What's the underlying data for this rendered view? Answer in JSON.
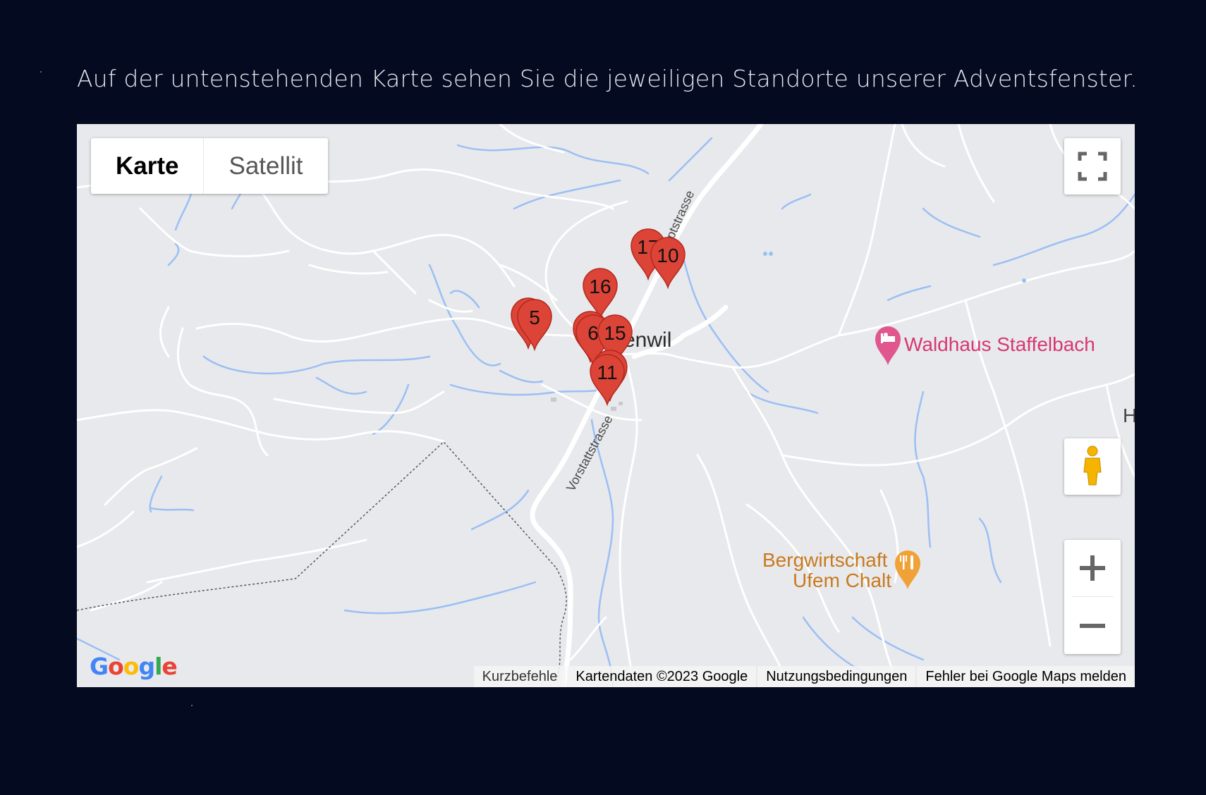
{
  "intro_text": "Auf der untenstehenden Karte sehen Sie die jeweiligen Standorte unserer Adventsfenster.",
  "map": {
    "map_type": {
      "map_label": "Karte",
      "satellite_label": "Satellit",
      "selected": "Karte"
    },
    "markers": [
      "17",
      "10",
      "16",
      "5",
      "6",
      "15",
      "11"
    ],
    "place_labels": {
      "village": "enwil",
      "hotel": "Waldhaus Staffelbach",
      "restaurant_line1": "Bergwirtschaft",
      "restaurant_line2": "Ufem Chalt",
      "edge_letter": "H"
    },
    "street_labels": {
      "main_street": "Hauptstrasse",
      "side_street": "Vorstattstrasse"
    },
    "footer": {
      "shortcuts": "Kurzbefehle",
      "map_data": "Kartendaten ©2023 Google",
      "terms": "Nutzungsbedingungen",
      "report": "Fehler bei Google Maps melden"
    },
    "logo_text": "Google",
    "icons": [
      "fullscreen-icon",
      "pegman-icon",
      "zoom-in-icon",
      "zoom-out-icon",
      "hotel-bed-icon",
      "restaurant-fork-icon"
    ],
    "colors": {
      "marker": "#db4437",
      "water": "#9bbff4",
      "road": "#ffffff",
      "land": "#e8e9ec",
      "hotel_label": "#d6386f",
      "restaurant_label": "#d98a2b"
    }
  }
}
